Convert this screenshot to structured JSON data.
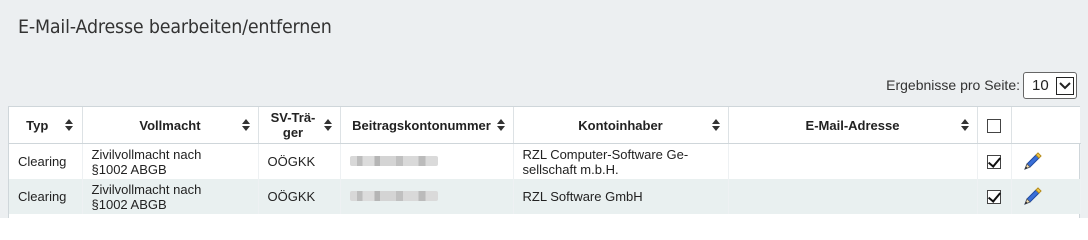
{
  "panel": {
    "title": "E-Mail-Adresse bearbeiten/entfernen"
  },
  "pagination": {
    "page_size_label": "Ergebnisse pro Seite:",
    "page_size_value": "10"
  },
  "table": {
    "headers": {
      "typ": "Typ",
      "vollmacht": "Vollmacht",
      "sv_traeger_line1": "SV-Trä-",
      "sv_traeger_line2": "ger",
      "beitragskontonummer": "Beitragskontonummer",
      "kontoinhaber": "Kontoinhaber",
      "email": "E-Mail-Adresse"
    },
    "rows": [
      {
        "typ": "Clearing",
        "vollmacht_line1": "Zivilvollmacht nach",
        "vollmacht_line2": "§1002 ABGB",
        "sv_traeger": "OÖGKK",
        "kontoinhaber_line1": "RZL Computer-Software Ge-",
        "kontoinhaber_line2": "sellschaft m.b.H.",
        "email": "",
        "selected": true
      },
      {
        "typ": "Clearing",
        "vollmacht_line1": "Zivilvollmacht nach",
        "vollmacht_line2": "§1002 ABGB",
        "sv_traeger": "OÖGKK",
        "kontoinhaber_line1": "RZL Software GmbH",
        "kontoinhaber_line2": "",
        "email": "",
        "selected": true
      }
    ]
  },
  "colors": {
    "panel_bg": "#eceff1",
    "alt_row": "#e9f0f0",
    "pencil_blue": "#3a6fd8",
    "pencil_yellow": "#f2c94c"
  },
  "icons": {
    "sort": "sort-updown-icon",
    "edit": "pencil-icon"
  }
}
